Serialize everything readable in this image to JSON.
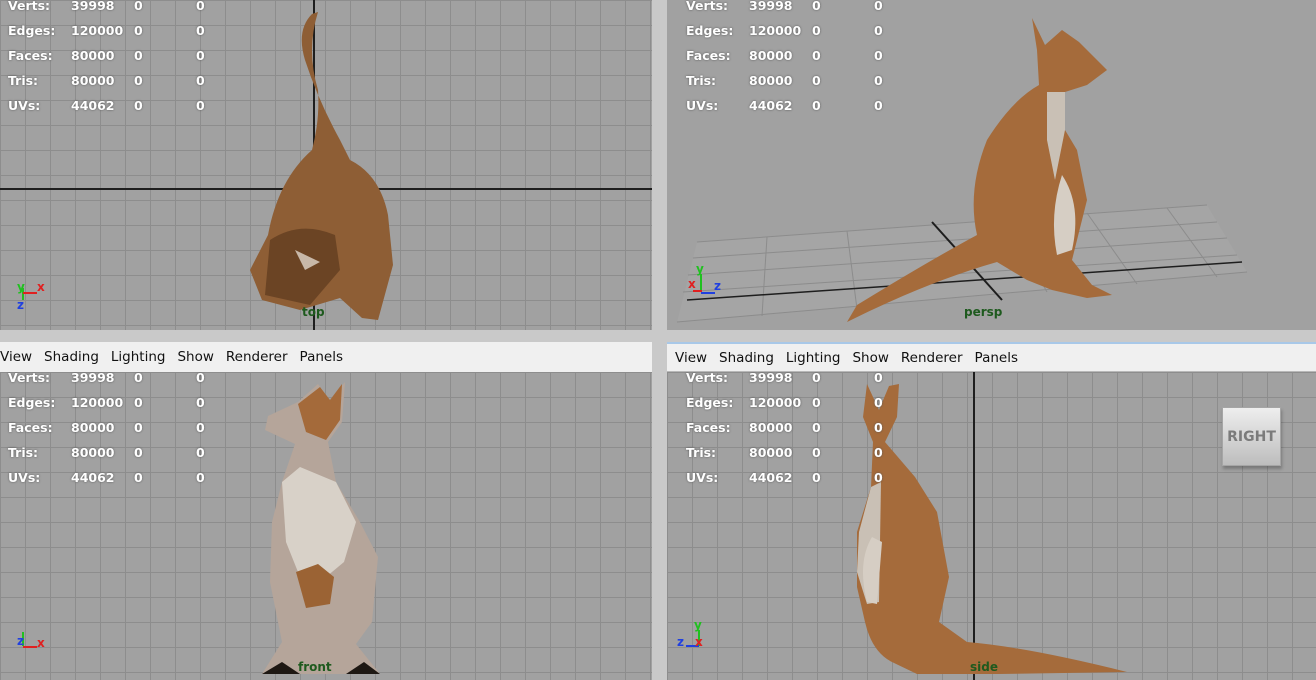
{
  "menu": [
    "View",
    "Shading",
    "Lighting",
    "Show",
    "Renderer",
    "Panels"
  ],
  "stats": [
    {
      "label": "Verts:",
      "v1": "39998",
      "v2": "0",
      "v3": "0"
    },
    {
      "label": "Edges:",
      "v1": "120000",
      "v2": "0",
      "v3": "0"
    },
    {
      "label": "Faces:",
      "v1": "80000",
      "v2": "0",
      "v3": "0"
    },
    {
      "label": "Tris:",
      "v1": "80000",
      "v2": "0",
      "v3": "0"
    },
    {
      "label": "UVs:",
      "v1": "44062",
      "v2": "0",
      "v3": "0"
    }
  ],
  "viewports": {
    "top": {
      "camera": "top",
      "axis_a": "y",
      "axis_b": "x",
      "axis_c": "z"
    },
    "persp": {
      "camera": "persp",
      "axis_a": "y",
      "axis_b": "x",
      "axis_c": "z"
    },
    "front": {
      "camera": "front",
      "axis_a": "z",
      "axis_b": "x"
    },
    "side": {
      "camera": "side",
      "axis_a": "y",
      "axis_b": "z",
      "axis_c": "x"
    }
  },
  "viewcube_label": "RIGHT",
  "colors": {
    "fur": "#a06a3c",
    "fur_dark": "#6e4423",
    "belly": "#d8d1c8",
    "grid": "#8d8d8d",
    "viewport_bg": "#a1a1a1",
    "axis_x": "#e02020",
    "axis_y": "#20c020",
    "axis_z": "#2040e0"
  }
}
